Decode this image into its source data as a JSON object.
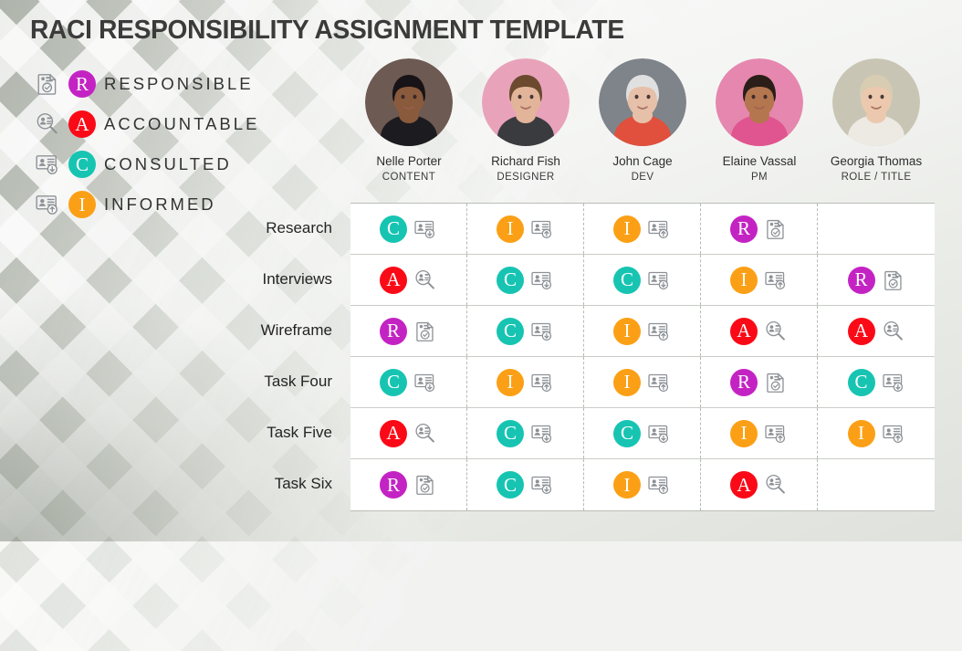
{
  "page": {
    "title": "RACI RESPONSIBILITY ASSIGNMENT TEMPLATE"
  },
  "colors": {
    "responsible": "#c423c4",
    "accountable": "#fa0a17",
    "consulted": "#17c4b2",
    "informed": "#fba016",
    "title_text": "#3b3b3b",
    "grid_line": "#c9cdc6",
    "cell_divider": "#b6bab3",
    "cell_bg": "#ffffff"
  },
  "legend": {
    "items": [
      {
        "key": "R",
        "letter": "R",
        "label": "RESPONSIBLE",
        "color": "#c423c4",
        "icon": "clipboard-check-icon"
      },
      {
        "key": "A",
        "letter": "A",
        "label": "ACCOUNTABLE",
        "color": "#fa0a17",
        "icon": "person-magnifier-icon"
      },
      {
        "key": "C",
        "letter": "C",
        "label": "CONSULTED",
        "color": "#17c4b2",
        "icon": "id-card-down-icon"
      },
      {
        "key": "I",
        "letter": "I",
        "label": "INFORMED",
        "color": "#fba016",
        "icon": "id-card-up-icon"
      }
    ]
  },
  "people": [
    {
      "name": "Nelle Porter",
      "role": "CONTENT",
      "avatar_bg": "#6d5a52",
      "skin": "#8a5a3c",
      "hair": "#181316",
      "cloth": "#1c1b20"
    },
    {
      "name": "Richard Fish",
      "role": "DESIGNER",
      "avatar_bg": "#e8a3bb",
      "skin": "#e2b49a",
      "hair": "#6b4a2f",
      "cloth": "#3a3b3f"
    },
    {
      "name": "John Cage",
      "role": "DEV",
      "avatar_bg": "#7e8489",
      "skin": "#e6c0a8",
      "hair": "#e0e0e0",
      "cloth": "#e0503c"
    },
    {
      "name": "Elaine Vassal",
      "role": "PM",
      "avatar_bg": "#e587ae",
      "skin": "#b4764f",
      "hair": "#2b1d18",
      "cloth": "#e0558f"
    },
    {
      "name": "Georgia Thomas",
      "role": "ROLE / TITLE",
      "avatar_bg": "#c9c5b4",
      "skin": "#ecc9ae",
      "hair": "#d8cdb2",
      "cloth": "#eceae2"
    }
  ],
  "matrix": {
    "rows": [
      {
        "task": "Research",
        "cells": [
          {
            "key": "C",
            "letter": "C",
            "color": "#17c4b2",
            "icon": "id-card-down-icon"
          },
          {
            "key": "I",
            "letter": "I",
            "color": "#fba016",
            "icon": "id-card-up-icon"
          },
          {
            "key": "I",
            "letter": "I",
            "color": "#fba016",
            "icon": "id-card-up-icon"
          },
          {
            "key": "R",
            "letter": "R",
            "color": "#c423c4",
            "icon": "clipboard-check-icon"
          },
          {
            "key": "",
            "letter": "",
            "color": "",
            "icon": ""
          }
        ]
      },
      {
        "task": "Interviews",
        "cells": [
          {
            "key": "A",
            "letter": "A",
            "color": "#fa0a17",
            "icon": "person-magnifier-icon"
          },
          {
            "key": "C",
            "letter": "C",
            "color": "#17c4b2",
            "icon": "id-card-down-icon"
          },
          {
            "key": "C",
            "letter": "C",
            "color": "#17c4b2",
            "icon": "id-card-down-icon"
          },
          {
            "key": "I",
            "letter": "I",
            "color": "#fba016",
            "icon": "id-card-up-icon"
          },
          {
            "key": "R",
            "letter": "R",
            "color": "#c423c4",
            "icon": "clipboard-check-icon"
          }
        ]
      },
      {
        "task": "Wireframe",
        "cells": [
          {
            "key": "R",
            "letter": "R",
            "color": "#c423c4",
            "icon": "clipboard-check-icon"
          },
          {
            "key": "C",
            "letter": "C",
            "color": "#17c4b2",
            "icon": "id-card-down-icon"
          },
          {
            "key": "I",
            "letter": "I",
            "color": "#fba016",
            "icon": "id-card-up-icon"
          },
          {
            "key": "A",
            "letter": "A",
            "color": "#fa0a17",
            "icon": "person-magnifier-icon"
          },
          {
            "key": "A",
            "letter": "A",
            "color": "#fa0a17",
            "icon": "person-magnifier-icon"
          }
        ]
      },
      {
        "task": "Task Four",
        "cells": [
          {
            "key": "C",
            "letter": "C",
            "color": "#17c4b2",
            "icon": "id-card-down-icon"
          },
          {
            "key": "I",
            "letter": "I",
            "color": "#fba016",
            "icon": "id-card-up-icon"
          },
          {
            "key": "I",
            "letter": "I",
            "color": "#fba016",
            "icon": "id-card-up-icon"
          },
          {
            "key": "R",
            "letter": "R",
            "color": "#c423c4",
            "icon": "clipboard-check-icon"
          },
          {
            "key": "C",
            "letter": "C",
            "color": "#17c4b2",
            "icon": "id-card-down-icon"
          }
        ]
      },
      {
        "task": "Task Five",
        "cells": [
          {
            "key": "A",
            "letter": "A",
            "color": "#fa0a17",
            "icon": "person-magnifier-icon"
          },
          {
            "key": "C",
            "letter": "C",
            "color": "#17c4b2",
            "icon": "id-card-down-icon"
          },
          {
            "key": "C",
            "letter": "C",
            "color": "#17c4b2",
            "icon": "id-card-down-icon"
          },
          {
            "key": "I",
            "letter": "I",
            "color": "#fba016",
            "icon": "id-card-up-icon"
          },
          {
            "key": "I",
            "letter": "I",
            "color": "#fba016",
            "icon": "id-card-up-icon"
          }
        ]
      },
      {
        "task": "Task Six",
        "cells": [
          {
            "key": "R",
            "letter": "R",
            "color": "#c423c4",
            "icon": "clipboard-check-icon"
          },
          {
            "key": "C",
            "letter": "C",
            "color": "#17c4b2",
            "icon": "id-card-down-icon"
          },
          {
            "key": "I",
            "letter": "I",
            "color": "#fba016",
            "icon": "id-card-up-icon"
          },
          {
            "key": "A",
            "letter": "A",
            "color": "#fa0a17",
            "icon": "person-magnifier-icon"
          },
          {
            "key": "",
            "letter": "",
            "color": "",
            "icon": ""
          }
        ]
      }
    ]
  }
}
